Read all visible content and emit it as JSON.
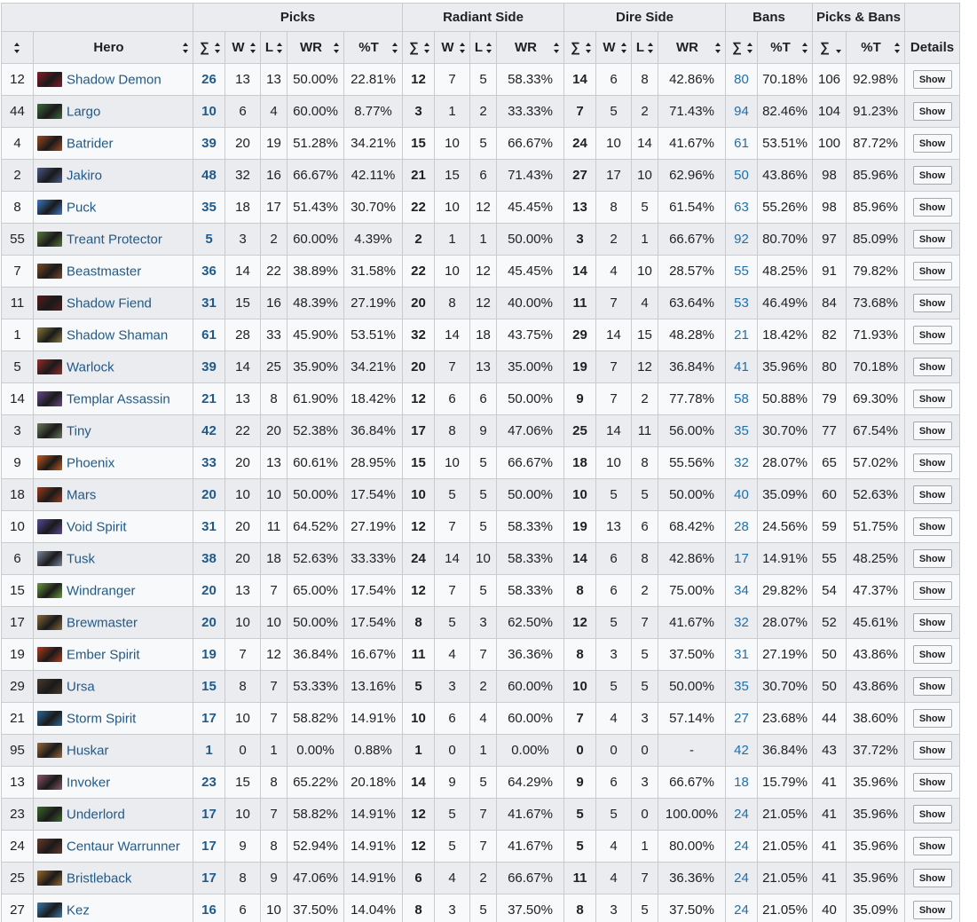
{
  "header": {
    "groups": {
      "picks": "Picks",
      "radiant": "Radiant Side",
      "dire": "Dire Side",
      "bans": "Bans",
      "picks_bans": "Picks & Bans"
    },
    "columns": {
      "rank": "",
      "hero": "Hero",
      "sum": "∑",
      "w": "W",
      "l": "L",
      "wr": "WR",
      "pct_t": "%T",
      "details": "Details"
    }
  },
  "button_label": "Show",
  "rows": [
    {
      "rank": "12",
      "hero": "Shadow Demon",
      "color": "#8b1a2a",
      "p": "26",
      "pw": "13",
      "pl": "13",
      "pwr": "50.00%",
      "pt": "22.81%",
      "r": "12",
      "rw": "7",
      "rl": "5",
      "rwr": "58.33%",
      "d": "14",
      "dw": "6",
      "dl": "8",
      "dwr": "42.86%",
      "b": "80",
      "bt": "70.18%",
      "pb": "106",
      "pbt": "92.98%"
    },
    {
      "rank": "44",
      "hero": "Largo",
      "color": "#3a6b3a",
      "p": "10",
      "pw": "6",
      "pl": "4",
      "pwr": "60.00%",
      "pt": "8.77%",
      "r": "3",
      "rw": "1",
      "rl": "2",
      "rwr": "33.33%",
      "d": "7",
      "dw": "5",
      "dl": "2",
      "dwr": "71.43%",
      "b": "94",
      "bt": "82.46%",
      "pb": "104",
      "pbt": "91.23%"
    },
    {
      "rank": "4",
      "hero": "Batrider",
      "color": "#a04a20",
      "p": "39",
      "pw": "20",
      "pl": "19",
      "pwr": "51.28%",
      "pt": "34.21%",
      "r": "15",
      "rw": "10",
      "rl": "5",
      "rwr": "66.67%",
      "d": "24",
      "dw": "10",
      "dl": "14",
      "dwr": "41.67%",
      "b": "61",
      "bt": "53.51%",
      "pb": "100",
      "pbt": "87.72%"
    },
    {
      "rank": "2",
      "hero": "Jakiro",
      "color": "#4a5a8a",
      "p": "48",
      "pw": "32",
      "pl": "16",
      "pwr": "66.67%",
      "pt": "42.11%",
      "r": "21",
      "rw": "15",
      "rl": "6",
      "rwr": "71.43%",
      "d": "27",
      "dw": "17",
      "dl": "10",
      "dwr": "62.96%",
      "b": "50",
      "bt": "43.86%",
      "pb": "98",
      "pbt": "85.96%"
    },
    {
      "rank": "8",
      "hero": "Puck",
      "color": "#3a7ac8",
      "p": "35",
      "pw": "18",
      "pl": "17",
      "pwr": "51.43%",
      "pt": "30.70%",
      "r": "22",
      "rw": "10",
      "rl": "12",
      "rwr": "45.45%",
      "d": "13",
      "dw": "8",
      "dl": "5",
      "dwr": "61.54%",
      "b": "63",
      "bt": "55.26%",
      "pb": "98",
      "pbt": "85.96%"
    },
    {
      "rank": "55",
      "hero": "Treant Protector",
      "color": "#5a7a3a",
      "p": "5",
      "pw": "3",
      "pl": "2",
      "pwr": "60.00%",
      "pt": "4.39%",
      "r": "2",
      "rw": "1",
      "rl": "1",
      "rwr": "50.00%",
      "d": "3",
      "dw": "2",
      "dl": "1",
      "dwr": "66.67%",
      "b": "92",
      "bt": "80.70%",
      "pb": "97",
      "pbt": "85.09%"
    },
    {
      "rank": "7",
      "hero": "Beastmaster",
      "color": "#7a4a2a",
      "p": "36",
      "pw": "14",
      "pl": "22",
      "pwr": "38.89%",
      "pt": "31.58%",
      "r": "22",
      "rw": "10",
      "rl": "12",
      "rwr": "45.45%",
      "d": "14",
      "dw": "4",
      "dl": "10",
      "dwr": "28.57%",
      "b": "55",
      "bt": "48.25%",
      "pb": "91",
      "pbt": "79.82%"
    },
    {
      "rank": "11",
      "hero": "Shadow Fiend",
      "color": "#5a1a1a",
      "p": "31",
      "pw": "15",
      "pl": "16",
      "pwr": "48.39%",
      "pt": "27.19%",
      "r": "20",
      "rw": "8",
      "rl": "12",
      "rwr": "40.00%",
      "d": "11",
      "dw": "7",
      "dl": "4",
      "dwr": "63.64%",
      "b": "53",
      "bt": "46.49%",
      "pb": "84",
      "pbt": "73.68%"
    },
    {
      "rank": "1",
      "hero": "Shadow Shaman",
      "color": "#8a7a3a",
      "p": "61",
      "pw": "28",
      "pl": "33",
      "pwr": "45.90%",
      "pt": "53.51%",
      "r": "32",
      "rw": "14",
      "rl": "18",
      "rwr": "43.75%",
      "d": "29",
      "dw": "14",
      "dl": "15",
      "dwr": "48.28%",
      "b": "21",
      "bt": "18.42%",
      "pb": "82",
      "pbt": "71.93%"
    },
    {
      "rank": "5",
      "hero": "Warlock",
      "color": "#9a2a2a",
      "p": "39",
      "pw": "14",
      "pl": "25",
      "pwr": "35.90%",
      "pt": "34.21%",
      "r": "20",
      "rw": "7",
      "rl": "13",
      "rwr": "35.00%",
      "d": "19",
      "dw": "7",
      "dl": "12",
      "dwr": "36.84%",
      "b": "41",
      "bt": "35.96%",
      "pb": "80",
      "pbt": "70.18%"
    },
    {
      "rank": "14",
      "hero": "Templar Assassin",
      "color": "#6a4a8a",
      "p": "21",
      "pw": "13",
      "pl": "8",
      "pwr": "61.90%",
      "pt": "18.42%",
      "r": "12",
      "rw": "6",
      "rl": "6",
      "rwr": "50.00%",
      "d": "9",
      "dw": "7",
      "dl": "2",
      "dwr": "77.78%",
      "b": "58",
      "bt": "50.88%",
      "pb": "79",
      "pbt": "69.30%"
    },
    {
      "rank": "3",
      "hero": "Tiny",
      "color": "#6a7a5a",
      "p": "42",
      "pw": "22",
      "pl": "20",
      "pwr": "52.38%",
      "pt": "36.84%",
      "r": "17",
      "rw": "8",
      "rl": "9",
      "rwr": "47.06%",
      "d": "25",
      "dw": "14",
      "dl": "11",
      "dwr": "56.00%",
      "b": "35",
      "bt": "30.70%",
      "pb": "77",
      "pbt": "67.54%"
    },
    {
      "rank": "9",
      "hero": "Phoenix",
      "color": "#c85a1a",
      "p": "33",
      "pw": "20",
      "pl": "13",
      "pwr": "60.61%",
      "pt": "28.95%",
      "r": "15",
      "rw": "10",
      "rl": "5",
      "rwr": "66.67%",
      "d": "18",
      "dw": "10",
      "dl": "8",
      "dwr": "55.56%",
      "b": "32",
      "bt": "28.07%",
      "pb": "65",
      "pbt": "57.02%"
    },
    {
      "rank": "18",
      "hero": "Mars",
      "color": "#a03a1a",
      "p": "20",
      "pw": "10",
      "pl": "10",
      "pwr": "50.00%",
      "pt": "17.54%",
      "r": "10",
      "rw": "5",
      "rl": "5",
      "rwr": "50.00%",
      "d": "10",
      "dw": "5",
      "dl": "5",
      "dwr": "50.00%",
      "b": "40",
      "bt": "35.09%",
      "pb": "60",
      "pbt": "52.63%"
    },
    {
      "rank": "10",
      "hero": "Void Spirit",
      "color": "#5a4a9a",
      "p": "31",
      "pw": "20",
      "pl": "11",
      "pwr": "64.52%",
      "pt": "27.19%",
      "r": "12",
      "rw": "7",
      "rl": "5",
      "rwr": "58.33%",
      "d": "19",
      "dw": "13",
      "dl": "6",
      "dwr": "68.42%",
      "b": "28",
      "bt": "24.56%",
      "pb": "59",
      "pbt": "51.75%"
    },
    {
      "rank": "6",
      "hero": "Tusk",
      "color": "#7a8aa0",
      "p": "38",
      "pw": "20",
      "pl": "18",
      "pwr": "52.63%",
      "pt": "33.33%",
      "r": "24",
      "rw": "14",
      "rl": "10",
      "rwr": "58.33%",
      "d": "14",
      "dw": "6",
      "dl": "8",
      "dwr": "42.86%",
      "b": "17",
      "bt": "14.91%",
      "pb": "55",
      "pbt": "48.25%"
    },
    {
      "rank": "15",
      "hero": "Windranger",
      "color": "#6a9a3a",
      "p": "20",
      "pw": "13",
      "pl": "7",
      "pwr": "65.00%",
      "pt": "17.54%",
      "r": "12",
      "rw": "7",
      "rl": "5",
      "rwr": "58.33%",
      "d": "8",
      "dw": "6",
      "dl": "2",
      "dwr": "75.00%",
      "b": "34",
      "bt": "29.82%",
      "pb": "54",
      "pbt": "47.37%"
    },
    {
      "rank": "17",
      "hero": "Brewmaster",
      "color": "#8a6a3a",
      "p": "20",
      "pw": "10",
      "pl": "10",
      "pwr": "50.00%",
      "pt": "17.54%",
      "r": "8",
      "rw": "5",
      "rl": "3",
      "rwr": "62.50%",
      "d": "12",
      "dw": "5",
      "dl": "7",
      "dwr": "41.67%",
      "b": "32",
      "bt": "28.07%",
      "pb": "52",
      "pbt": "45.61%"
    },
    {
      "rank": "19",
      "hero": "Ember Spirit",
      "color": "#b83a1a",
      "p": "19",
      "pw": "7",
      "pl": "12",
      "pwr": "36.84%",
      "pt": "16.67%",
      "r": "11",
      "rw": "4",
      "rl": "7",
      "rwr": "36.36%",
      "d": "8",
      "dw": "3",
      "dl": "5",
      "dwr": "37.50%",
      "b": "31",
      "bt": "27.19%",
      "pb": "50",
      "pbt": "43.86%"
    },
    {
      "rank": "29",
      "hero": "Ursa",
      "color": "#4a3a2a",
      "p": "15",
      "pw": "8",
      "pl": "7",
      "pwr": "53.33%",
      "pt": "13.16%",
      "r": "5",
      "rw": "3",
      "rl": "2",
      "rwr": "60.00%",
      "d": "10",
      "dw": "5",
      "dl": "5",
      "dwr": "50.00%",
      "b": "35",
      "bt": "30.70%",
      "pb": "50",
      "pbt": "43.86%"
    },
    {
      "rank": "21",
      "hero": "Storm Spirit",
      "color": "#2a6a9a",
      "p": "17",
      "pw": "10",
      "pl": "7",
      "pwr": "58.82%",
      "pt": "14.91%",
      "r": "10",
      "rw": "6",
      "rl": "4",
      "rwr": "60.00%",
      "d": "7",
      "dw": "4",
      "dl": "3",
      "dwr": "57.14%",
      "b": "27",
      "bt": "23.68%",
      "pb": "44",
      "pbt": "38.60%"
    },
    {
      "rank": "95",
      "hero": "Huskar",
      "color": "#9a6a3a",
      "p": "1",
      "pw": "0",
      "pl": "1",
      "pwr": "0.00%",
      "pt": "0.88%",
      "r": "1",
      "rw": "0",
      "rl": "1",
      "rwr": "0.00%",
      "d": "0",
      "dw": "0",
      "dl": "0",
      "dwr": "-",
      "b": "42",
      "bt": "36.84%",
      "pb": "43",
      "pbt": "37.72%"
    },
    {
      "rank": "13",
      "hero": "Invoker",
      "color": "#8a5a6a",
      "p": "23",
      "pw": "15",
      "pl": "8",
      "pwr": "65.22%",
      "pt": "20.18%",
      "r": "14",
      "rw": "9",
      "rl": "5",
      "rwr": "64.29%",
      "d": "9",
      "dw": "6",
      "dl": "3",
      "dwr": "66.67%",
      "b": "18",
      "bt": "15.79%",
      "pb": "41",
      "pbt": "35.96%"
    },
    {
      "rank": "23",
      "hero": "Underlord",
      "color": "#3a6a2a",
      "p": "17",
      "pw": "10",
      "pl": "7",
      "pwr": "58.82%",
      "pt": "14.91%",
      "r": "12",
      "rw": "5",
      "rl": "7",
      "rwr": "41.67%",
      "d": "5",
      "dw": "5",
      "dl": "0",
      "dwr": "100.00%",
      "b": "24",
      "bt": "21.05%",
      "pb": "41",
      "pbt": "35.96%"
    },
    {
      "rank": "24",
      "hero": "Centaur Warrunner",
      "color": "#6a3a2a",
      "p": "17",
      "pw": "9",
      "pl": "8",
      "pwr": "52.94%",
      "pt": "14.91%",
      "r": "12",
      "rw": "5",
      "rl": "7",
      "rwr": "41.67%",
      "d": "5",
      "dw": "4",
      "dl": "1",
      "dwr": "80.00%",
      "b": "24",
      "bt": "21.05%",
      "pb": "41",
      "pbt": "35.96%"
    },
    {
      "rank": "25",
      "hero": "Bristleback",
      "color": "#9a6a2a",
      "p": "17",
      "pw": "8",
      "pl": "9",
      "pwr": "47.06%",
      "pt": "14.91%",
      "r": "6",
      "rw": "4",
      "rl": "2",
      "rwr": "66.67%",
      "d": "11",
      "dw": "4",
      "dl": "7",
      "dwr": "36.36%",
      "b": "24",
      "bt": "21.05%",
      "pb": "41",
      "pbt": "35.96%"
    },
    {
      "rank": "27",
      "hero": "Kez",
      "color": "#3a7ab0",
      "p": "16",
      "pw": "6",
      "pl": "10",
      "pwr": "37.50%",
      "pt": "14.04%",
      "r": "8",
      "rw": "3",
      "rl": "5",
      "rwr": "37.50%",
      "d": "8",
      "dw": "3",
      "dl": "5",
      "dwr": "37.50%",
      "b": "24",
      "bt": "21.05%",
      "pb": "40",
      "pbt": "35.09%"
    }
  ]
}
